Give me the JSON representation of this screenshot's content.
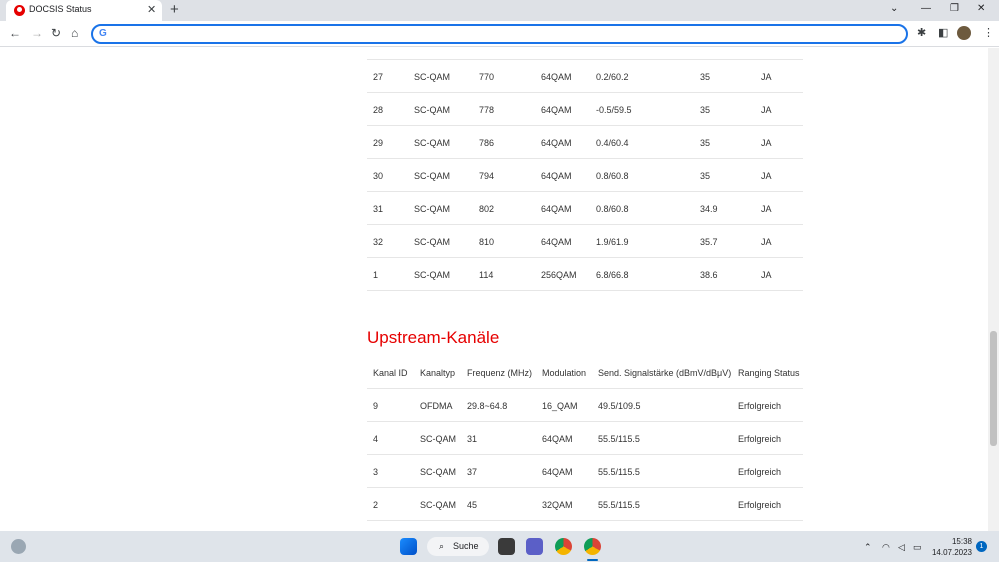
{
  "browser": {
    "tab_title": "DOCSIS Status",
    "omnibox_value": ""
  },
  "downstream_rows": [
    {
      "id": "27",
      "type": "SC-QAM",
      "freq": "770",
      "mod": "64QAM",
      "power": "0.2/60.2",
      "mer": "35",
      "locked": "JA"
    },
    {
      "id": "28",
      "type": "SC-QAM",
      "freq": "778",
      "mod": "64QAM",
      "power": "-0.5/59.5",
      "mer": "35",
      "locked": "JA"
    },
    {
      "id": "29",
      "type": "SC-QAM",
      "freq": "786",
      "mod": "64QAM",
      "power": "0.4/60.4",
      "mer": "35",
      "locked": "JA"
    },
    {
      "id": "30",
      "type": "SC-QAM",
      "freq": "794",
      "mod": "64QAM",
      "power": "0.8/60.8",
      "mer": "35",
      "locked": "JA"
    },
    {
      "id": "31",
      "type": "SC-QAM",
      "freq": "802",
      "mod": "64QAM",
      "power": "0.8/60.8",
      "mer": "34.9",
      "locked": "JA"
    },
    {
      "id": "32",
      "type": "SC-QAM",
      "freq": "810",
      "mod": "64QAM",
      "power": "1.9/61.9",
      "mer": "35.7",
      "locked": "JA"
    },
    {
      "id": "1",
      "type": "SC-QAM",
      "freq": "114",
      "mod": "256QAM",
      "power": "6.8/66.8",
      "mer": "38.6",
      "locked": "JA"
    }
  ],
  "upstream": {
    "title": "Upstream-Kanäle",
    "headers": [
      "Kanal ID",
      "Kanaltyp",
      "Frequenz (MHz)",
      "Modulation",
      "Send. Signalstärke (dBmV/dBμV)",
      "Ranging Status"
    ],
    "rows": [
      {
        "id": "9",
        "type": "OFDMA",
        "freq": "29.8~64.8",
        "mod": "16_QAM",
        "power": "49.5/109.5",
        "status": "Erfolgreich"
      },
      {
        "id": "4",
        "type": "SC-QAM",
        "freq": "31",
        "mod": "64QAM",
        "power": "55.5/115.5",
        "status": "Erfolgreich"
      },
      {
        "id": "3",
        "type": "SC-QAM",
        "freq": "37",
        "mod": "64QAM",
        "power": "55.5/115.5",
        "status": "Erfolgreich"
      },
      {
        "id": "2",
        "type": "SC-QAM",
        "freq": "45",
        "mod": "32QAM",
        "power": "55.5/115.5",
        "status": "Erfolgreich"
      }
    ]
  },
  "taskbar": {
    "search_label": "Suche",
    "time": "15:38",
    "date": "14.07.2023",
    "notification_count": "1"
  },
  "colors": {
    "accent": "#e60000",
    "omnibox_focus": "#1a73e8"
  }
}
